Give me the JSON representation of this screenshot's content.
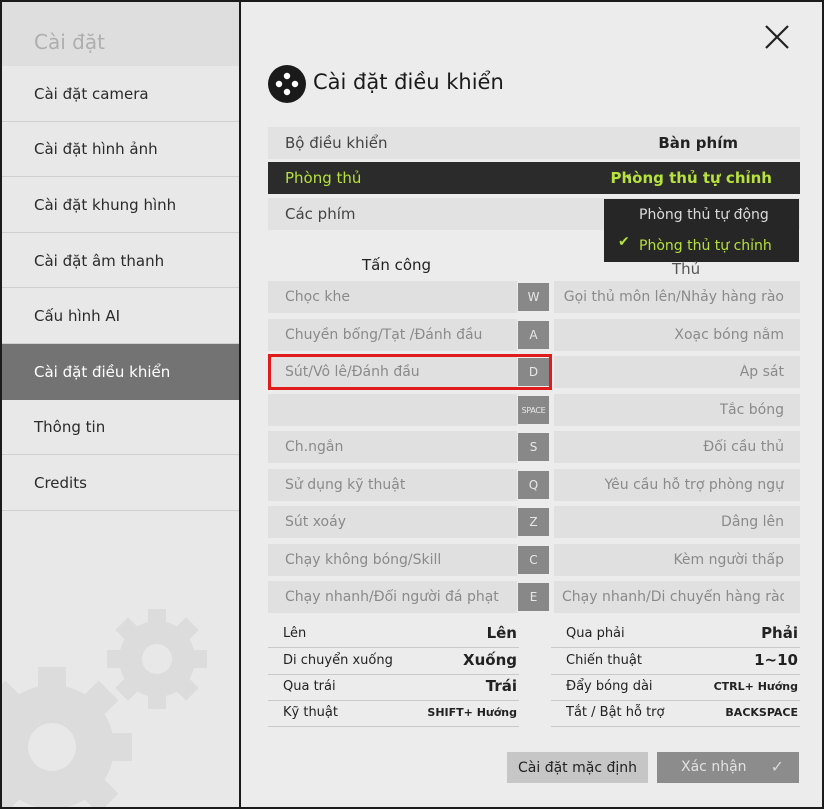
{
  "sidebar": {
    "title": "Cài đặt",
    "items": [
      {
        "label": "Cài đặt camera"
      },
      {
        "label": "Cài đặt hình ảnh"
      },
      {
        "label": "Cài đặt khung hình"
      },
      {
        "label": "Cài đặt âm thanh"
      },
      {
        "label": "Cấu hình AI"
      },
      {
        "label": "Cài đặt điều khiển",
        "active": true
      },
      {
        "label": "Thông tin"
      },
      {
        "label": "Credits"
      }
    ]
  },
  "header": {
    "title": "Cài đặt điều khiển",
    "icon": "gamepad-icon",
    "close_icon": "close-icon"
  },
  "controls": {
    "controller": {
      "label": "Bộ điều khiển",
      "value": "Bàn phím"
    },
    "defense": {
      "label": "Phòng thủ",
      "value": "Phòng thủ tự chỉnh"
    },
    "keys": {
      "label": "Các phím"
    }
  },
  "dropdown": {
    "options": [
      "Phòng thủ tự động",
      "Phòng thủ tự chỉnh"
    ],
    "selected": "Phòng thủ tự chỉnh"
  },
  "columns": {
    "attack": "Tấn công",
    "defense": "Thủ"
  },
  "keymap": [
    {
      "attack": "Chọc khe",
      "key": "W",
      "defense": "Gọi thủ môn lên/Nhảy hàng rào"
    },
    {
      "attack": "Chuyền bổng/Tạt /Đánh đầu",
      "key": "A",
      "defense": "Xoạc bóng nằm"
    },
    {
      "attack": "Sút/Vô lê/Đánh đầu",
      "key": "D",
      "defense": "Áp sát"
    },
    {
      "attack": "",
      "key": "SPACE",
      "defense": "Tắc bóng"
    },
    {
      "attack": "Ch.ngắn",
      "key": "S",
      "defense": "Đổi cầu thủ"
    },
    {
      "attack": "Sử dụng kỹ thuật",
      "key": "Q",
      "defense": "Yêu cầu hỗ trợ phòng ngự"
    },
    {
      "attack": "Sút xoáy",
      "key": "Z",
      "defense": "Dâng lên"
    },
    {
      "attack": "Chạy không bóng/Skill",
      "key": "C",
      "defense": "Kèm người thấp"
    },
    {
      "attack": "Chạy nhanh/Đổi người đá phạt",
      "key": "E",
      "defense": "Chạy nhanh/Di chuyển hàng rào"
    }
  ],
  "bindings_left": [
    {
      "label": "Lên",
      "value": "Lên"
    },
    {
      "label": "Di chuyển xuống",
      "value": "Xuống"
    },
    {
      "label": "Qua trái",
      "value": "Trái"
    },
    {
      "label": "Kỹ thuật",
      "value": "SHIFT+ Hướng"
    }
  ],
  "bindings_right": [
    {
      "label": "Qua phải",
      "value": "Phải"
    },
    {
      "label": "Chiến thuật",
      "value": "1~10"
    },
    {
      "label": "Đẩy bóng dài",
      "value": "CTRL+ Hướng"
    },
    {
      "label": "Tắt / Bật hỗ trợ",
      "value": "BACKSPACE"
    }
  ],
  "buttons": {
    "default": "Cài đặt mặc định",
    "confirm": "Xác nhận"
  },
  "colors": {
    "accent": "#b6e23b",
    "highlight": "#e01b1b",
    "active_sidebar": "#737373",
    "dark_row": "#2b2b2b"
  }
}
